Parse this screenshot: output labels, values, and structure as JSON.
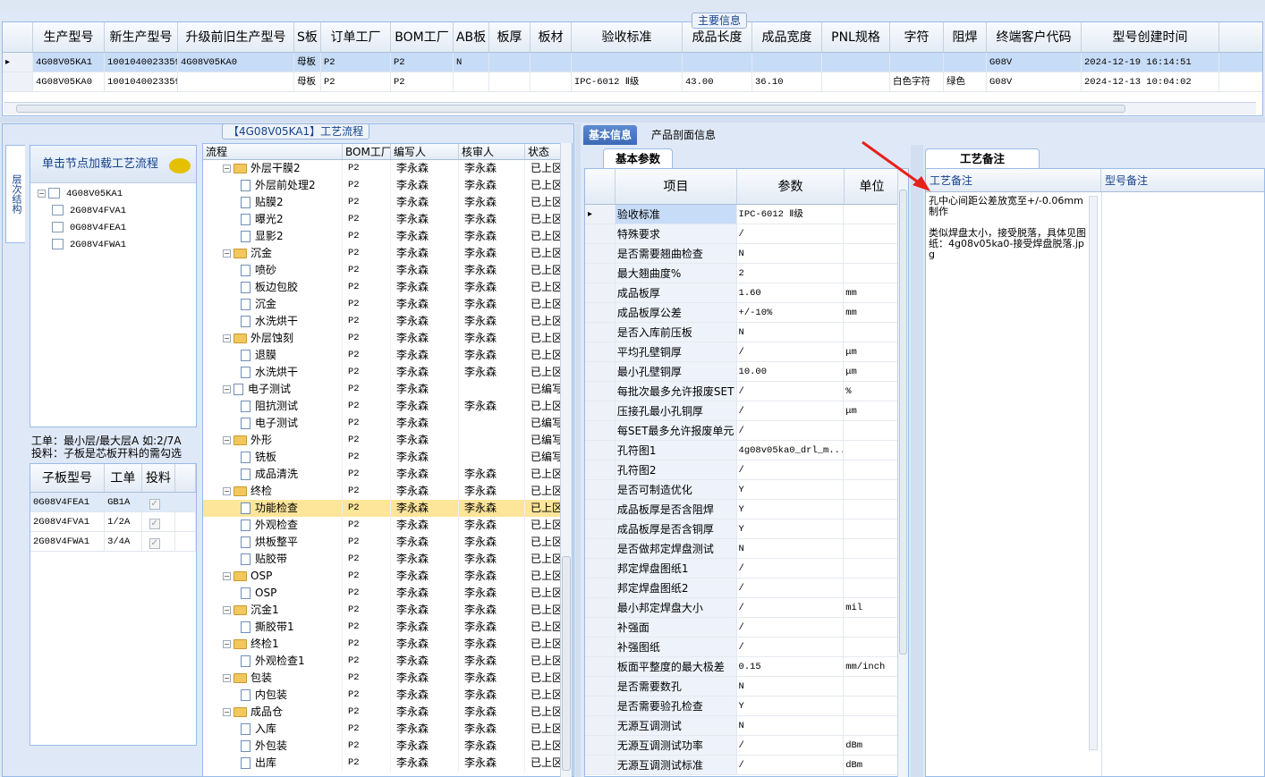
{
  "main_info": {
    "title": "主要信息",
    "columns": [
      "生产型号",
      "新生产型号",
      "升级前旧生产型号",
      "S板",
      "订单工厂",
      "BOM工厂",
      "AB板",
      "板厚",
      "板材",
      "验收标准",
      "成品长度",
      "成品宽度",
      "PNL规格",
      "字符",
      "阻焊",
      "终端客户代码",
      "型号创建时间"
    ],
    "rows": [
      [
        "4G08V05KA1",
        "10010400233597",
        "4G08V05KA0",
        "母板",
        "P2",
        "P2",
        "N",
        "",
        "",
        "",
        "",
        "",
        "",
        "",
        "",
        "G08V",
        "2024-12-19 16:14:51"
      ],
      [
        "4G08V05KA0",
        "10010400233597",
        "",
        "母板",
        "P2",
        "P2",
        "",
        "",
        "",
        "IPC-6012 Ⅱ级",
        "43.00",
        "36.10",
        "",
        "白色字符",
        "绿色",
        "G08V",
        "2024-12-13 10:04:02"
      ]
    ]
  },
  "left": {
    "vertical_tab": "层次结构",
    "tree_header": "单击节点加载工艺流程",
    "tree_root": "4G08V05KA1",
    "tree_children": [
      "2G08V4FVA1",
      "0G08V4FEA1",
      "2G08V4FWA1"
    ],
    "info_line1": "工单：最小层/最大层A 如:2/7A",
    "info_line2": "投料：子板是芯板开料的需勾选",
    "sub_columns": [
      "子板型号",
      "工单",
      "投料"
    ],
    "sub_rows": [
      [
        "0G08V4FEA1",
        "GB1A"
      ],
      [
        "2G08V4FVA1",
        "1/2A"
      ],
      [
        "2G08V4FWA1",
        "3/4A"
      ]
    ]
  },
  "flow": {
    "title": "【4G08V05KA1】工艺流程",
    "columns": [
      "流程",
      "BOM工厂",
      "编写人",
      "核审人",
      "状态"
    ],
    "rows": [
      {
        "name": "外层干膜2",
        "level": 0,
        "folder": true,
        "bom": "P2",
        "writer": "李永森",
        "reviewer": "李永森",
        "status": "已上区"
      },
      {
        "name": "外层前处理2",
        "level": 1,
        "folder": false,
        "bom": "P2",
        "writer": "李永森",
        "reviewer": "李永森",
        "status": "已上区"
      },
      {
        "name": "贴膜2",
        "level": 1,
        "folder": false,
        "bom": "P2",
        "writer": "李永森",
        "reviewer": "李永森",
        "status": "已上区"
      },
      {
        "name": "曝光2",
        "level": 1,
        "folder": false,
        "bom": "P2",
        "writer": "李永森",
        "reviewer": "李永森",
        "status": "已上区"
      },
      {
        "name": "显影2",
        "level": 1,
        "folder": false,
        "bom": "P2",
        "writer": "李永森",
        "reviewer": "李永森",
        "status": "已上区"
      },
      {
        "name": "沉金",
        "level": 0,
        "folder": true,
        "bom": "P2",
        "writer": "李永森",
        "reviewer": "李永森",
        "status": "已上区"
      },
      {
        "name": "喷砂",
        "level": 1,
        "folder": false,
        "bom": "P2",
        "writer": "李永森",
        "reviewer": "李永森",
        "status": "已上区"
      },
      {
        "name": "板边包胶",
        "level": 1,
        "folder": false,
        "bom": "P2",
        "writer": "李永森",
        "reviewer": "李永森",
        "status": "已上区"
      },
      {
        "name": "沉金",
        "level": 1,
        "folder": false,
        "bom": "P2",
        "writer": "李永森",
        "reviewer": "李永森",
        "status": "已上区"
      },
      {
        "name": "水洗烘干",
        "level": 1,
        "folder": false,
        "bom": "P2",
        "writer": "李永森",
        "reviewer": "李永森",
        "status": "已上区"
      },
      {
        "name": "外层蚀刻",
        "level": 0,
        "folder": true,
        "bom": "P2",
        "writer": "李永森",
        "reviewer": "李永森",
        "status": "已上区"
      },
      {
        "name": "退膜",
        "level": 1,
        "folder": false,
        "bom": "P2",
        "writer": "李永森",
        "reviewer": "李永森",
        "status": "已上区"
      },
      {
        "name": "水洗烘干",
        "level": 1,
        "folder": false,
        "bom": "P2",
        "writer": "李永森",
        "reviewer": "李永森",
        "status": "已上区"
      },
      {
        "name": "电子测试",
        "level": 0,
        "folder": false,
        "bom": "P2",
        "writer": "李永森",
        "reviewer": "",
        "status": "已编写"
      },
      {
        "name": "阻抗测试",
        "level": 1,
        "folder": false,
        "bom": "P2",
        "writer": "李永森",
        "reviewer": "李永森",
        "status": "已上区"
      },
      {
        "name": "电子测试",
        "level": 1,
        "folder": false,
        "bom": "P2",
        "writer": "李永森",
        "reviewer": "",
        "status": "已编写"
      },
      {
        "name": "外形",
        "level": 0,
        "folder": true,
        "bom": "P2",
        "writer": "李永森",
        "reviewer": "",
        "status": "已编写"
      },
      {
        "name": "铣板",
        "level": 1,
        "folder": false,
        "bom": "P2",
        "writer": "李永森",
        "reviewer": "",
        "status": "已编写"
      },
      {
        "name": "成品清洗",
        "level": 1,
        "folder": false,
        "bom": "P2",
        "writer": "李永森",
        "reviewer": "李永森",
        "status": "已上区"
      },
      {
        "name": "终检",
        "level": 0,
        "folder": true,
        "bom": "P2",
        "writer": "李永森",
        "reviewer": "李永森",
        "status": "已上区"
      },
      {
        "name": "功能检查",
        "level": 1,
        "folder": false,
        "bom": "P2",
        "writer": "李永森",
        "reviewer": "李永森",
        "status": "已上区",
        "selected": true
      },
      {
        "name": "外观检查",
        "level": 1,
        "folder": false,
        "bom": "P2",
        "writer": "李永森",
        "reviewer": "李永森",
        "status": "已上区"
      },
      {
        "name": "烘板整平",
        "level": 1,
        "folder": false,
        "bom": "P2",
        "writer": "李永森",
        "reviewer": "李永森",
        "status": "已上区"
      },
      {
        "name": "贴胶带",
        "level": 1,
        "folder": false,
        "bom": "P2",
        "writer": "李永森",
        "reviewer": "李永森",
        "status": "已上区"
      },
      {
        "name": "OSP",
        "level": 0,
        "folder": true,
        "bom": "P2",
        "writer": "李永森",
        "reviewer": "李永森",
        "status": "已上区"
      },
      {
        "name": "OSP",
        "level": 1,
        "folder": false,
        "bom": "P2",
        "writer": "李永森",
        "reviewer": "李永森",
        "status": "已上区"
      },
      {
        "name": "沉金1",
        "level": 0,
        "folder": true,
        "bom": "P2",
        "writer": "李永森",
        "reviewer": "李永森",
        "status": "已上区"
      },
      {
        "name": "撕胶带1",
        "level": 1,
        "folder": false,
        "bom": "P2",
        "writer": "李永森",
        "reviewer": "李永森",
        "status": "已上区"
      },
      {
        "name": "终检1",
        "level": 0,
        "folder": true,
        "bom": "P2",
        "writer": "李永森",
        "reviewer": "李永森",
        "status": "已上区"
      },
      {
        "name": "外观检查1",
        "level": 1,
        "folder": false,
        "bom": "P2",
        "writer": "李永森",
        "reviewer": "李永森",
        "status": "已上区"
      },
      {
        "name": "包装",
        "level": 0,
        "folder": true,
        "bom": "P2",
        "writer": "李永森",
        "reviewer": "李永森",
        "status": "已上区"
      },
      {
        "name": "内包装",
        "level": 1,
        "folder": false,
        "bom": "P2",
        "writer": "李永森",
        "reviewer": "李永森",
        "status": "已上区"
      },
      {
        "name": "成品仓",
        "level": 0,
        "folder": true,
        "bom": "P2",
        "writer": "李永森",
        "reviewer": "李永森",
        "status": "已上区"
      },
      {
        "name": "入库",
        "level": 1,
        "folder": false,
        "bom": "P2",
        "writer": "李永森",
        "reviewer": "李永森",
        "status": "已上区"
      },
      {
        "name": "外包装",
        "level": 1,
        "folder": false,
        "bom": "P2",
        "writer": "李永森",
        "reviewer": "李永森",
        "status": "已上区"
      },
      {
        "name": "出库",
        "level": 1,
        "folder": false,
        "bom": "P2",
        "writer": "李永森",
        "reviewer": "李永森",
        "status": "已上区"
      }
    ]
  },
  "middle": {
    "tabs": [
      "基本信息",
      "产品剖面信息"
    ],
    "sub_tab": "基本参数",
    "columns": [
      "项目",
      "参数",
      "单位"
    ],
    "rows": [
      [
        "验收标准",
        "IPC-6012 Ⅱ级",
        "",
        "Y"
      ],
      [
        "特殊要求",
        "/",
        "",
        "Y"
      ],
      [
        "是否需要翘曲检查",
        "N",
        "",
        "Y"
      ],
      [
        "最大翘曲度%",
        "2",
        "",
        "Y"
      ],
      [
        "成品板厚",
        "1.60",
        "mm",
        "Y"
      ],
      [
        "成品板厚公差",
        "+/-10%",
        "mm",
        "Y"
      ],
      [
        "是否入库前压板",
        "N",
        "",
        "Y"
      ],
      [
        "平均孔壁铜厚",
        "/",
        "μm",
        "Y"
      ],
      [
        "最小孔壁铜厚",
        "10.00",
        "μm",
        "Y"
      ],
      [
        "每批次最多允许报废SET",
        "/",
        "%",
        "Y"
      ],
      [
        "压接孔最小孔铜厚",
        "/",
        "μm",
        "Y"
      ],
      [
        "每SET最多允许报废单元",
        "/",
        "",
        "Y"
      ],
      [
        "孔符图1",
        "4g08v05ka0_drl_m...",
        "",
        "Y"
      ],
      [
        "孔符图2",
        "/",
        "",
        "Y"
      ],
      [
        "是否可制造优化",
        "Y",
        "",
        "Y"
      ],
      [
        "成品板厚是否含阻焊",
        "Y",
        "",
        "Y"
      ],
      [
        "成品板厚是否含铜厚",
        "Y",
        "",
        "Y"
      ],
      [
        "是否做邦定焊盘测试",
        "N",
        "",
        "Y"
      ],
      [
        "邦定焊盘图纸1",
        "/",
        "",
        "Y"
      ],
      [
        "邦定焊盘图纸2",
        "/",
        "",
        "Y"
      ],
      [
        "最小邦定焊盘大小",
        "/",
        "mil",
        "Y"
      ],
      [
        "补强面",
        "/",
        "",
        "Y"
      ],
      [
        "补强图纸",
        "/",
        "",
        "Y"
      ],
      [
        "板面平整度的最大极差",
        "0.15",
        "mm/inch",
        "Y"
      ],
      [
        "是否需要数孔",
        "N",
        "",
        "Y"
      ],
      [
        "是否需要验孔检查",
        "Y",
        "",
        "Y"
      ],
      [
        "无源互调测试",
        "N",
        "",
        "Y"
      ],
      [
        "无源互调测试功率",
        "/",
        "dBm",
        "Y"
      ],
      [
        "无源互调测试标准",
        "/",
        "dBm",
        "Y"
      ]
    ]
  },
  "right": {
    "tab": "工艺备注",
    "col1": "工艺备注",
    "col2": "型号备注",
    "remark": "孔中心间距公差放宽至+/-0.06mm制作\n\n类似焊盘太小，接受脱落，具体见图纸：4g08v05ka0-接受焊盘脱落.jpg"
  },
  "colors": {
    "accent": "#15428b",
    "selected_row": "#c7dcf7",
    "selected_flow": "#fde59a",
    "arrow": "#e8201a"
  }
}
